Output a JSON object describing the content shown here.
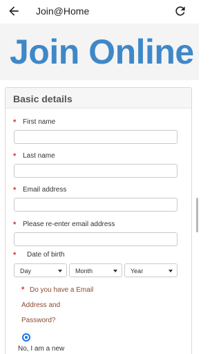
{
  "appbar": {
    "title": "Join@Home"
  },
  "hero": {
    "heading": "Join Online"
  },
  "section": {
    "title": "Basic details"
  },
  "fields": {
    "first_name": {
      "label": "First name",
      "value": ""
    },
    "last_name": {
      "label": "Last name",
      "value": ""
    },
    "email": {
      "label": "Email address",
      "value": ""
    },
    "email_confirm": {
      "label": "Please re-enter email address",
      "value": ""
    }
  },
  "dob": {
    "label": "Date of birth",
    "day": "Day",
    "month": "Month",
    "year": "Year"
  },
  "question": {
    "line1": "Do you have a Email",
    "line2": "Address and",
    "line3": "Password?",
    "option_label": "No, I am a new",
    "selected": true
  },
  "required_marker": "*",
  "colors": {
    "accent": "#3f88c8",
    "required": "#d32f2f",
    "question_text": "#8b4a2f",
    "radio": "#1a73e8"
  },
  "icons": {
    "back": "arrow-left-icon",
    "refresh": "refresh-icon"
  }
}
